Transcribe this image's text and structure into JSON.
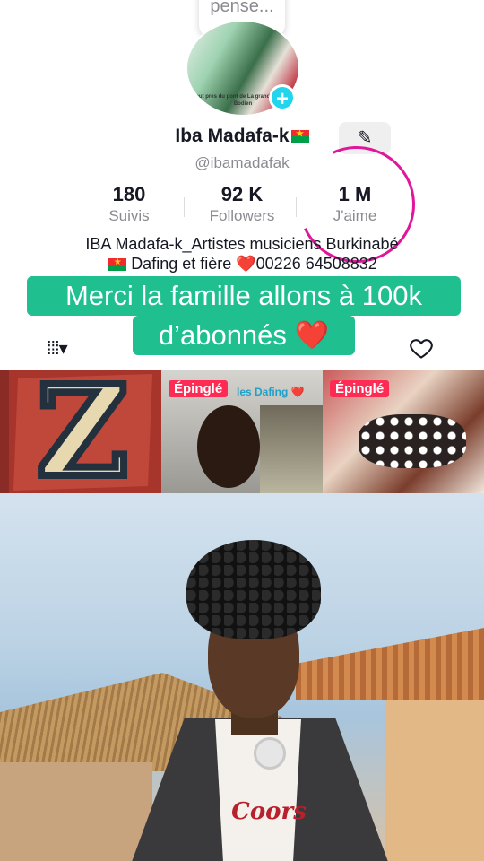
{
  "bubble": {
    "text": "pense..."
  },
  "profile": {
    "name": "Iba Madafa-k",
    "handle": "@ibamadafak",
    "edit_icon": "pencil-icon",
    "avatar_flyer_text": "Tout près du pont de La grande voie de Bodien"
  },
  "stats": [
    {
      "value": "180",
      "label": "Suivis"
    },
    {
      "value": "92 K",
      "label": "Followers"
    },
    {
      "value": "1 M",
      "label": "J'aime"
    }
  ],
  "bio": {
    "line1": "IBA Madafa-k_Artistes musiciens Burkinabé",
    "line2": "Dafing et fière ❤️00226 64508832"
  },
  "caption": {
    "line1": "Merci la famille allons à 100k",
    "line2": "d’abonnés ❤️"
  },
  "tabs": {
    "grid_icon": "grid-icon",
    "grid_symbol": "⁞⁞⁞▾",
    "liked_icon": "heart-outline-icon"
  },
  "thumbnails": [
    {
      "pinned": "",
      "caption": ""
    },
    {
      "pinned": "Épinglé",
      "caption": "les Dafing ❤️"
    },
    {
      "pinned": "Épinglé",
      "caption": ""
    }
  ],
  "video": {
    "shirt_text": "Coors"
  },
  "colors": {
    "accent_teal": "#1fbf8f",
    "pinned_red": "#fe2c55",
    "circle_pink": "#e0169b",
    "add_cyan": "#20d5ec"
  }
}
